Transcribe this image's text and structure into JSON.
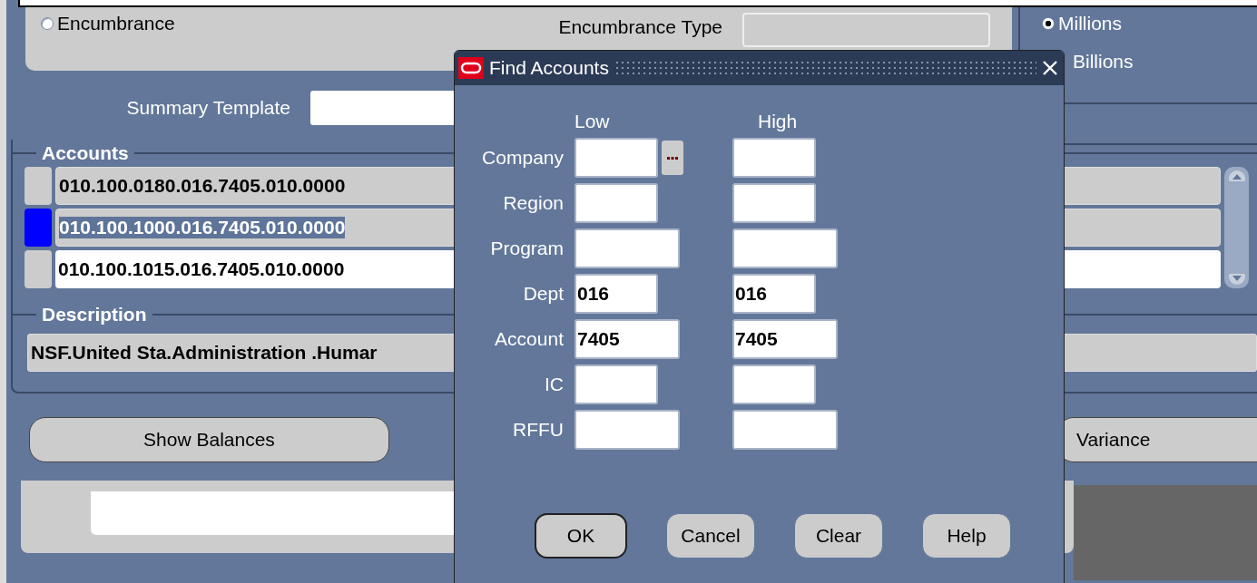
{
  "form": {
    "balance_option": {
      "label": "Encumbrance",
      "selected": false
    },
    "encumbrance_type": {
      "label": "Encumbrance Type"
    },
    "units_option": {
      "label": "Millions",
      "selected": true
    },
    "units_option_2": {
      "label": "Billions"
    },
    "summary_template": {
      "label": "Summary Template"
    },
    "accounts": {
      "title": "Accounts",
      "rows": [
        {
          "value": "010.100.0180.016.7405.010.0000",
          "selected": false,
          "kind": "readonly"
        },
        {
          "value": "010.100.1000.016.7405.010.0000",
          "selected": true,
          "kind": "readonly"
        },
        {
          "value": "010.100.1015.016.7405.010.0000",
          "selected": false,
          "kind": "editable"
        }
      ]
    },
    "description": {
      "title": "Description",
      "value": "NSF.United Sta.Administration .Humar"
    },
    "buttons": [
      {
        "label": "Show Balances"
      },
      {
        "label": "Variance"
      }
    ]
  },
  "dialog": {
    "title": "Find Accounts",
    "columns": [
      "Low",
      "High"
    ],
    "rows": [
      {
        "label": "Company",
        "kind": "short",
        "lov": true
      },
      {
        "label": "Region",
        "kind": "short",
        "lov": false
      },
      {
        "label": "Program",
        "kind": "long",
        "lov": false
      },
      {
        "label": "Dept",
        "kind": "short",
        "lov": false,
        "low": "016",
        "high": "016"
      },
      {
        "label": "Account",
        "kind": "long",
        "lov": false,
        "low": "7405",
        "high": "7405"
      },
      {
        "label": "IC",
        "kind": "short",
        "lov": false
      },
      {
        "label": "RFFU",
        "kind": "long",
        "lov": false
      }
    ],
    "buttons": [
      {
        "label": "OK",
        "default": true
      },
      {
        "label": "Cancel",
        "default": false
      },
      {
        "label": "Clear",
        "default": false
      },
      {
        "label": "Help",
        "default": false
      }
    ]
  }
}
